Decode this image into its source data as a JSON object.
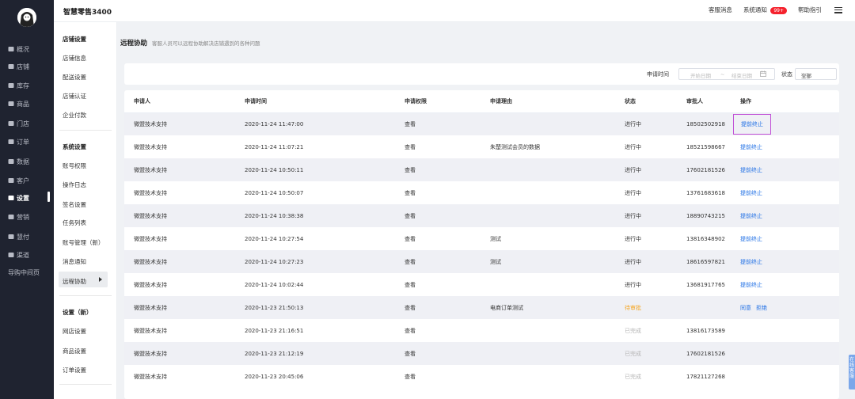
{
  "app": {
    "title": "智慧零售3400"
  },
  "header_links": {
    "customer_msg": "客服消息",
    "system_notice": "系统通知",
    "notice_badge": "99+",
    "help": "帮助指引"
  },
  "nav": {
    "items": [
      {
        "label": "概况",
        "icon": "home-icon"
      },
      {
        "label": "店铺",
        "icon": "store-icon"
      },
      {
        "label": "库存",
        "icon": "inventory-icon"
      },
      {
        "label": "商品",
        "icon": "goods-icon"
      },
      {
        "label": "门店",
        "icon": "shop-icon"
      },
      {
        "label": "订单",
        "icon": "order-icon"
      },
      {
        "label": "数据",
        "icon": "data-icon"
      },
      {
        "label": "客户",
        "icon": "customer-icon"
      },
      {
        "label": "设置",
        "icon": "gear-icon"
      },
      {
        "label": "营销",
        "icon": "marketing-icon"
      },
      {
        "label": "慧付",
        "icon": "pay-icon"
      },
      {
        "label": "渠道",
        "icon": "channel-icon"
      }
    ],
    "extra": "导购中间页"
  },
  "subnav": {
    "g1": [
      "店铺设置",
      "店铺信息",
      "配送设置",
      "店铺认证",
      "企业付款"
    ],
    "g2": [
      "系统设置",
      "账号权限",
      "操作日志",
      "签名设置",
      "任务列表",
      "账号管理（新）",
      "消息通知",
      "远程协助"
    ],
    "g3": [
      "设置（新）",
      "网店设置",
      "商品设置",
      "订单设置"
    ]
  },
  "page": {
    "title": "远程协助",
    "desc": "客服人员可以远程协助解决店铺遇到的各种问题"
  },
  "filter": {
    "apply_time_label": "申请时间",
    "start_placeholder": "开始日期",
    "range_sep": "~",
    "end_placeholder": "结束日期",
    "status_label": "状态",
    "status_value": "全部"
  },
  "table": {
    "headers": [
      "申请人",
      "申请时间",
      "申请权限",
      "申请理由",
      "状态",
      "审批人",
      "操作"
    ],
    "rows": [
      {
        "applicant": "微盟技术支持",
        "time": "2020-11-24 11:47:00",
        "perm": "查看",
        "reason": "",
        "status": "进行中",
        "approver": "18502502918",
        "actions": [
          "提前终止"
        ]
      },
      {
        "applicant": "微盟技术支持",
        "time": "2020-11-24 11:07:21",
        "perm": "查看",
        "reason": "朱楚测试会员的数据",
        "status": "进行中",
        "approver": "18521598667",
        "actions": [
          "提前终止"
        ]
      },
      {
        "applicant": "微盟技术支持",
        "time": "2020-11-24 10:50:11",
        "perm": "查看",
        "reason": "",
        "status": "进行中",
        "approver": "17602181526",
        "actions": [
          "提前终止"
        ]
      },
      {
        "applicant": "微盟技术支持",
        "time": "2020-11-24 10:50:07",
        "perm": "查看",
        "reason": "",
        "status": "进行中",
        "approver": "13761683618",
        "actions": [
          "提前终止"
        ]
      },
      {
        "applicant": "微盟技术支持",
        "time": "2020-11-24 10:38:38",
        "perm": "查看",
        "reason": "",
        "status": "进行中",
        "approver": "18890743215",
        "actions": [
          "提前终止"
        ]
      },
      {
        "applicant": "微盟技术支持",
        "time": "2020-11-24 10:27:54",
        "perm": "查看",
        "reason": "测试",
        "status": "进行中",
        "approver": "13816348902",
        "actions": [
          "提前终止"
        ]
      },
      {
        "applicant": "微盟技术支持",
        "time": "2020-11-24 10:27:23",
        "perm": "查看",
        "reason": "测试",
        "status": "进行中",
        "approver": "18616597821",
        "actions": [
          "提前终止"
        ]
      },
      {
        "applicant": "微盟技术支持",
        "time": "2020-11-24 10:02:44",
        "perm": "查看",
        "reason": "",
        "status": "进行中",
        "approver": "13681917765",
        "actions": [
          "提前终止"
        ]
      },
      {
        "applicant": "微盟技术支持",
        "time": "2020-11-23 21:50:13",
        "perm": "查看",
        "reason": "电商订单测试",
        "status": "待审批",
        "approver": "",
        "actions": [
          "同意",
          "拒绝"
        ]
      },
      {
        "applicant": "微盟技术支持",
        "time": "2020-11-23 21:16:51",
        "perm": "查看",
        "reason": "",
        "status": "已完成",
        "approver": "13816173589",
        "actions": []
      },
      {
        "applicant": "微盟技术支持",
        "time": "2020-11-23 21:12:19",
        "perm": "查看",
        "reason": "",
        "status": "已完成",
        "approver": "17602181526",
        "actions": []
      },
      {
        "applicant": "微盟技术支持",
        "time": "2020-11-23 20:45:06",
        "perm": "查看",
        "reason": "",
        "status": "已完成",
        "approver": "17821127268",
        "actions": []
      }
    ]
  },
  "float_button": "在线客服",
  "colors": {
    "accent": "#1f6fe5",
    "nav_bg": "#1f2330",
    "pending": "#f5a623",
    "done": "#b4b4b4",
    "badge": "#f5222d"
  }
}
